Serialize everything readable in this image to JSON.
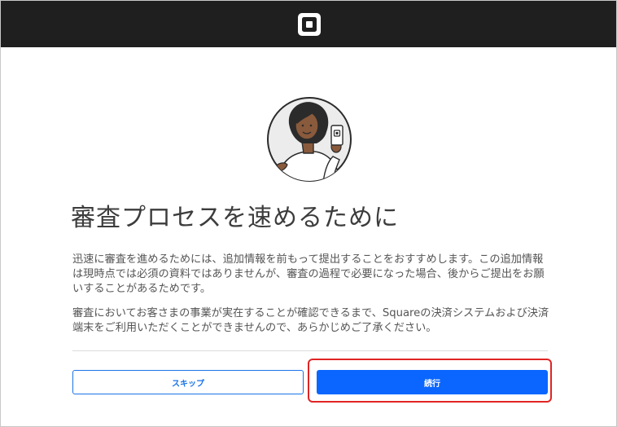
{
  "header": {
    "logo_icon": "square-logo-icon"
  },
  "illustration": {
    "icon": "person-holding-phone-illustration"
  },
  "main": {
    "title": "審査プロセスを速めるために",
    "paragraph1": "迅速に審査を進めるためには、追加情報を前もって提出することをおすすめします。この追加情報は現時点では必須の資料ではありませんが、審査の過程で必要になった場合、後からご提出をお願いすることがあるためです。",
    "paragraph2": "審査においてお客さまの事業が実在することが確認できるまで、Squareの決済システムおよび決済端末をご利用いただくことができませんので、あらかじめご了承ください。"
  },
  "actions": {
    "skip_label": "スキップ",
    "continue_label": "続行"
  },
  "colors": {
    "topbar": "#1f1f1f",
    "primary": "#0a66ff",
    "highlight": "#e02424"
  }
}
